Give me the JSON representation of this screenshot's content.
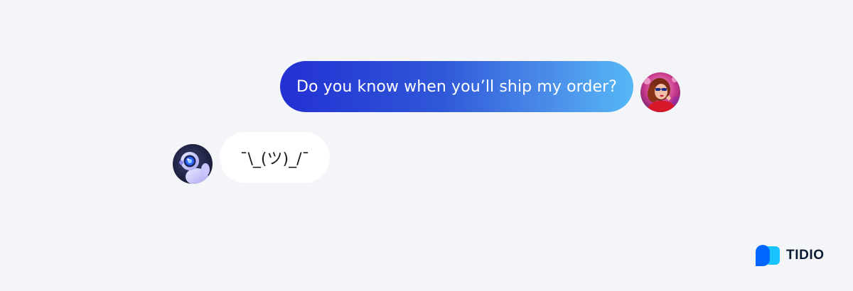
{
  "conversation": {
    "user_message": {
      "text": "Do you know when you’ll ship my order?",
      "avatar": "user-avatar-photo"
    },
    "bot_message": {
      "text": "¯\\_(ツ)_/¯",
      "avatar": "robot-avatar"
    }
  },
  "brand": {
    "name": "TIDIO",
    "icon": "tidio-logo-icon"
  },
  "colors": {
    "background": "#f4f5f8",
    "user_bubble_gradient_start": "#2330d3",
    "user_bubble_gradient_end": "#56b8f6",
    "bot_bubble": "#ffffff",
    "brand_icon_blue": "#0066ff",
    "brand_icon_light": "#19c3ff"
  }
}
